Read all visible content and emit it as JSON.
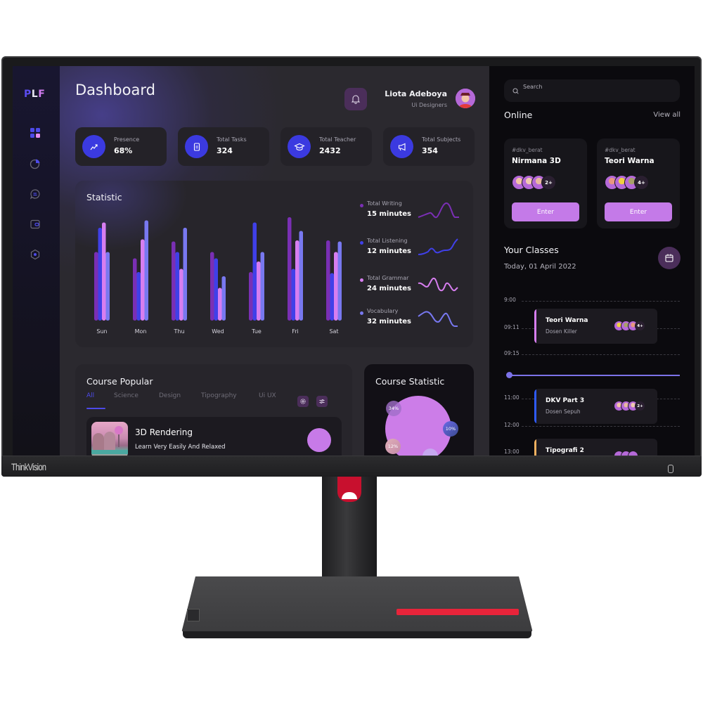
{
  "device": {
    "brand_label": "ThinkVision"
  },
  "sidebar": {
    "logo": {
      "p": "P",
      "l": "L",
      "f": "F"
    },
    "items": [
      {
        "name": "dashboard",
        "icon": "grid-icon",
        "active": true
      },
      {
        "name": "analytics",
        "icon": "pie-chart-icon",
        "active": false
      },
      {
        "name": "messages",
        "icon": "chat-icon",
        "active": false
      },
      {
        "name": "wallet",
        "icon": "wallet-icon",
        "active": false
      },
      {
        "name": "settings",
        "icon": "settings-icon",
        "active": false
      }
    ]
  },
  "header": {
    "title": "Dashboard",
    "user_name": "Liota Adeboya",
    "user_role": "Ui Designers"
  },
  "stats": [
    {
      "label": "Presence",
      "value": "68%",
      "icon": "trending-up-icon"
    },
    {
      "label": "Total Tasks",
      "value": "324",
      "icon": "document-icon"
    },
    {
      "label": "Total Teacher",
      "value": "2432",
      "icon": "graduation-cap-icon"
    },
    {
      "label": "Total Subjects",
      "value": "354",
      "icon": "megaphone-icon"
    }
  ],
  "statistic": {
    "title": "Statistic",
    "legend": [
      {
        "label": "Total Writing",
        "value": "15 minutes",
        "color": "#7a2fb4"
      },
      {
        "label": "Total Listening",
        "value": "12 minutes",
        "color": "#4040e8"
      },
      {
        "label": "Total Grammar",
        "value": "24 minutes",
        "color": "#d77ef0"
      },
      {
        "label": "Vocabulary",
        "value": "32 minutes",
        "color": "#7878f0"
      }
    ]
  },
  "chart_data": {
    "type": "bar",
    "title": "Statistic",
    "categories": [
      "Sun",
      "Mon",
      "Thu",
      "Wed",
      "Tue",
      "Fri",
      "Sat"
    ],
    "series": [
      {
        "name": "Total Writing",
        "color": "#7a2fb4",
        "values": [
          65,
          59,
          75,
          65,
          46,
          98,
          76
        ]
      },
      {
        "name": "Total Listening",
        "color": "#4040e8",
        "values": [
          88,
          46,
          65,
          59,
          93,
          49,
          45
        ]
      },
      {
        "name": "Total Grammar",
        "color": "#d77ef0",
        "values": [
          93,
          77,
          49,
          31,
          56,
          76,
          65
        ]
      },
      {
        "name": "Vocabulary",
        "color": "#7878f0",
        "values": [
          65,
          95,
          88,
          42,
          65,
          85,
          75
        ]
      }
    ],
    "xlabel": "",
    "ylabel": "",
    "ylim": [
      0,
      100
    ],
    "grid": false,
    "legend_position": "right"
  },
  "course_popular": {
    "title": "Course Popular",
    "tabs": [
      "All",
      "Science",
      "Design",
      "Tipography",
      "Ui UX"
    ],
    "active_tab": "All",
    "items": [
      {
        "name": "3D Rendering",
        "description": "Learn Very Easily And Relaxed"
      }
    ]
  },
  "course_statistic": {
    "title": "Course Statistic",
    "bubbles": [
      "34%",
      "10%",
      "12%"
    ]
  },
  "right_panel": {
    "search_placeholder": "Search",
    "online_title": "Online",
    "view_all": "View all",
    "online_cards": [
      {
        "tag": "#dkv_berat",
        "name": "Nirmana 3D",
        "more": "2+",
        "button": "Enter"
      },
      {
        "tag": "#dkv_berat",
        "name": "Teori Warna",
        "more": "4+",
        "button": "Enter"
      }
    ],
    "classes_title": "Your Classes",
    "classes_date": "Today, 01 April 2022",
    "time_labels": [
      "9:00",
      "09:11",
      "09:15",
      "11:00",
      "12:00",
      "13:00"
    ],
    "classes": [
      {
        "name": "Teori Warna",
        "teacher": "Dosen Killer",
        "more": "4+",
        "accent": "#d77ef0"
      },
      {
        "name": "DKV Part 3",
        "teacher": "Dosen Sepuh",
        "more": "2+",
        "accent": "#2f5bff"
      },
      {
        "name": "Tipografi 2",
        "teacher": "",
        "more": "",
        "accent": "#f0b060"
      }
    ]
  }
}
